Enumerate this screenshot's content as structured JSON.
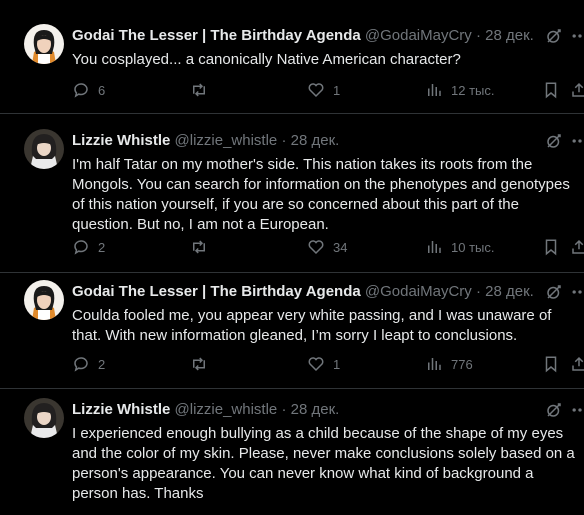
{
  "colors": {
    "background": "#000000",
    "text_primary": "#e7e9ea",
    "text_secondary": "#71767b",
    "divider": "#2f3336"
  },
  "tweets": [
    {
      "name": "Godai The Lesser | The Birthday Agenda",
      "handle": "@GodaiMayCry",
      "dot": "·",
      "time": "28 дек.",
      "lines": [
        "You cosplayed... a canonically Native American character?"
      ],
      "replies": "6",
      "retweets": "",
      "likes": "1",
      "views": "12 тыс."
    },
    {
      "name": "Lizzie Whistle",
      "handle": "@lizzie_whistle",
      "dot": "·",
      "time": "28 дек.",
      "lines": [
        "I'm half Tatar on my mother's side. This nation takes its roots from the",
        "Mongols. You can search for information on the phenotypes and genotypes",
        "of this nation yourself, if you are so concerned about this part of the",
        "question. But no, I am not a European."
      ],
      "replies": "2",
      "retweets": "",
      "likes": "34",
      "views": "10 тыс."
    },
    {
      "name": "Godai The Lesser | The Birthday Agenda",
      "handle": "@GodaiMayCry",
      "dot": "·",
      "time": "28 дек.",
      "lines": [
        "Coulda fooled me, you appear very white passing, and I was unaware of",
        "that. With new information gleaned, I’m sorry I leapt to conclusions."
      ],
      "replies": "2",
      "retweets": "",
      "likes": "1",
      "views": "776"
    },
    {
      "name": "Lizzie Whistle",
      "handle": "@lizzie_whistle",
      "dot": "·",
      "time": "28 дек.",
      "lines": [
        "I experienced enough bullying as a child because of the shape of my eyes",
        "and the color of my skin. Please, never make conclusions solely based on a",
        "person's appearance. You can never know what kind of background a",
        "person has. Thanks"
      ]
    }
  ],
  "icons": {
    "reply": "reply-icon",
    "retweet": "retweet-icon",
    "like": "heart-icon",
    "views": "views-icon",
    "bookmark": "bookmark-icon",
    "share": "share-icon",
    "grok": "grok-icon",
    "more": "more-icon"
  }
}
